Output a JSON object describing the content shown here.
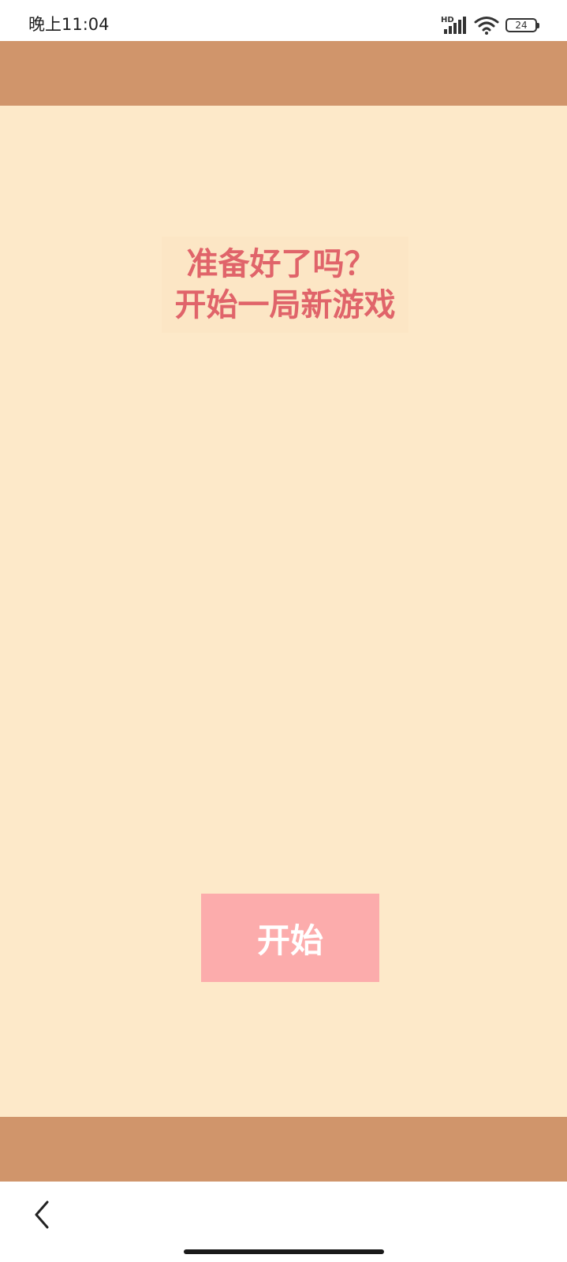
{
  "status_bar": {
    "time": "晚上11:04",
    "network_label": "HD",
    "battery_level": "24",
    "icons": [
      "hd-signal-icon",
      "wifi-icon",
      "battery-icon"
    ]
  },
  "game": {
    "prompt_line_1": "准备好了吗？",
    "prompt_line_2": "开始一局新游戏",
    "start_button_label": "开始"
  },
  "navigation": {
    "back_icon": "back-arrow-icon",
    "home_indicator": "home-indicator"
  },
  "colors": {
    "band": "#d0956b",
    "background": "#fde9c9",
    "prompt_text": "#e0646a",
    "button_bg": "#fcacac",
    "button_text": "#ffffff"
  }
}
